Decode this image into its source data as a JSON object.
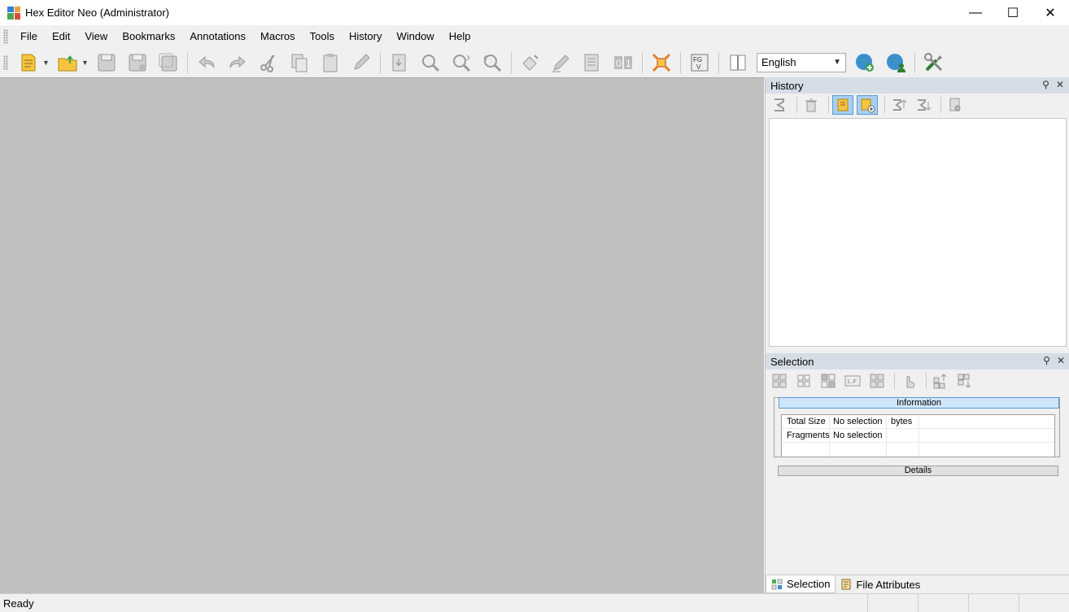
{
  "window": {
    "title": "Hex Editor Neo (Administrator)",
    "minimize": "—",
    "maximize": "☐",
    "close": "✕"
  },
  "menu": [
    "File",
    "Edit",
    "View",
    "Bookmarks",
    "Annotations",
    "Macros",
    "Tools",
    "History",
    "Window",
    "Help"
  ],
  "toolbar": {
    "language": "English"
  },
  "history_panel": {
    "title": "History"
  },
  "selection_panel": {
    "title": "Selection",
    "information_label": "Information",
    "rows": [
      {
        "label": "Total Size",
        "value": "No selection",
        "unit": "bytes"
      },
      {
        "label": "Fragments",
        "value": "No selection",
        "unit": ""
      }
    ],
    "details_label": "Details"
  },
  "dock_tabs": {
    "selection": "Selection",
    "file_attributes": "File Attributes"
  },
  "status": {
    "text": "Ready"
  }
}
